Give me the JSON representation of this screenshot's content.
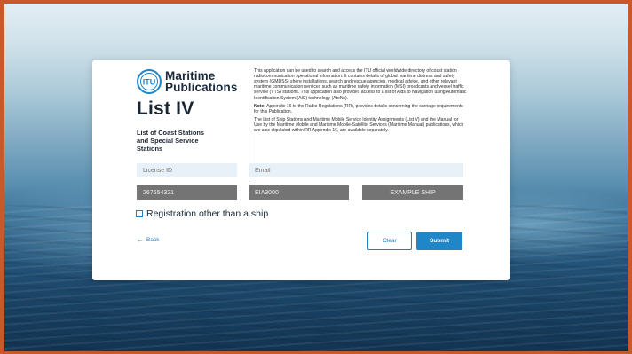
{
  "brand": {
    "logo_text": "ITU",
    "title_line1": "Maritime",
    "title_line2": "Publications",
    "list_title": "List IV",
    "list_subtitle": "List of Coast Stations and Special Service Stations"
  },
  "description": {
    "paragraph1": "This application can be used to search and access the ITU official worldwide directory of coast station radiocommunication operational information. It contains details of global maritime distress and safety system (GMDSS) shore installations, search and rescue agencies, medical advice, and other relevant maritime communication services such as maritime safety information (MSI) broadcasts and vessel traffic service (VTS) stations. This application also provides access to a list of Aids to Navigation using Automatic Identification System (AIS) technology (AtoNs).",
    "note_label": "Note:",
    "paragraph2": " Appendix 16 to the Radio Regulations (RR), provides details concerning the carriage requirements for this Publication.",
    "paragraph3": "The List of Ship Stations and Maritime Mobile Service Identity Assignments (List V) and the Manual for Use by the Maritime Mobile and Maritime Mobile-Satellite Services (Maritime Manual) publications, which are also stipulated within RR Appendix 16, are available separately."
  },
  "form": {
    "license_placeholder": "License ID",
    "email_placeholder": "Email",
    "mmsi_value": "267654321",
    "callsign_value": "EIA3000",
    "shipname_value": "EXAMPLE SHIP",
    "registration_label": "Registration other than a ship",
    "back_label": "Back",
    "clear_label": "Clear",
    "submit_label": "Submit"
  },
  "colors": {
    "accent": "#1f86c8",
    "dark_field": "#747474",
    "light_field": "#e8f1f7"
  }
}
